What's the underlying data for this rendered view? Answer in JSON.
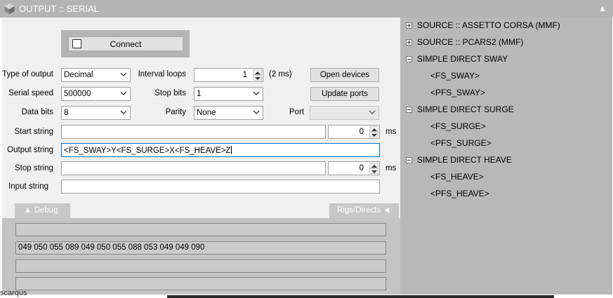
{
  "window": {
    "title": "OUTPUT :: SERIAL",
    "collapse_glyph": "▲",
    "logo_icon": "app-cube-icon"
  },
  "connect": {
    "label": "Connect",
    "checked": false
  },
  "fields": {
    "type_of_output": {
      "label": "Type of output",
      "value": "Decimal"
    },
    "serial_speed": {
      "label": "Serial speed",
      "value": "500000"
    },
    "data_bits": {
      "label": "Data bits",
      "value": "8"
    },
    "interval_loops": {
      "label": "Interval loops",
      "value": "1",
      "unit": "(2 ms)"
    },
    "stop_bits": {
      "label": "Stop bits",
      "value": "1"
    },
    "parity": {
      "label": "Parity",
      "value": "None"
    },
    "port": {
      "label": "Port",
      "value": ""
    },
    "start_string": {
      "label": "Start string",
      "value": "",
      "delay": "0",
      "unit": "ms"
    },
    "output_string": {
      "label": "Output string",
      "value": "<FS_SWAY>Y<FS_SURGE>X<FS_HEAVE>Z"
    },
    "stop_string": {
      "label": "Stop string",
      "value": "",
      "delay": "0",
      "unit": "ms"
    },
    "input_string": {
      "label": "Input string",
      "value": ""
    }
  },
  "buttons": {
    "open_devices": "Open devices",
    "update_ports": "Update ports"
  },
  "tabs": {
    "debug": "▲  Debug",
    "rigs": "Rigs/Directs  ◄"
  },
  "debug_lines": [
    "",
    "049 050 055 089 049 050 055 088 053 049 049 090",
    "",
    ""
  ],
  "tree": [
    {
      "kind": "group",
      "expanded": false,
      "label": "SOURCE :: ASSETTO CORSA (MMF)"
    },
    {
      "kind": "group",
      "expanded": false,
      "label": "SOURCE :: PCARS2 (MMF)"
    },
    {
      "kind": "group",
      "expanded": true,
      "label": "SIMPLE DIRECT SWAY"
    },
    {
      "kind": "leaf",
      "label": "<FS_SWAY>"
    },
    {
      "kind": "leaf",
      "label": "<PFS_SWAY>"
    },
    {
      "kind": "group",
      "expanded": true,
      "label": "SIMPLE DIRECT SURGE"
    },
    {
      "kind": "leaf",
      "label": "<FS_SURGE>"
    },
    {
      "kind": "leaf",
      "label": "<PFS_SURGE>"
    },
    {
      "kind": "group",
      "expanded": true,
      "label": "SIMPLE DIRECT HEAVE"
    },
    {
      "kind": "leaf",
      "label": "<FS_HEAVE>"
    },
    {
      "kind": "leaf",
      "label": "<PFS_HEAVE>"
    }
  ],
  "background_partial_text": "scarqus",
  "colors": {
    "titlebar": "#b4b4b4",
    "panel": "#f0f0f0",
    "tree_bg": "#b8b8b8",
    "debug_bg": "#c4c4c4",
    "focus_border": "#0078d7"
  }
}
